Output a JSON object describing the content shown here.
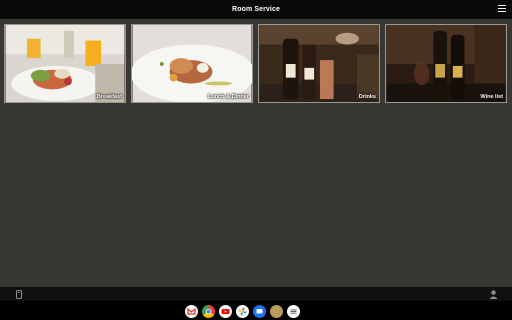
{
  "header": {
    "title": "Room Service",
    "menu_icon": "hamburger-menu-icon"
  },
  "tiles": [
    {
      "label": "Breakfast"
    },
    {
      "label": "Lunch & Dinner"
    },
    {
      "label": "Drinks"
    },
    {
      "label": "Wine list"
    }
  ],
  "bottom_bar": {
    "left_icon": "phone-icon",
    "right_icon": "person-icon"
  },
  "dock": {
    "apps": [
      "gmail-icon",
      "chrome-icon",
      "youtube-icon",
      "photos-icon",
      "messages-icon",
      "gold-app-icon",
      "app-drawer-icon"
    ]
  },
  "colors": {
    "background": "#383733",
    "topbar": "#0a0a0a",
    "dock": "#000000"
  }
}
